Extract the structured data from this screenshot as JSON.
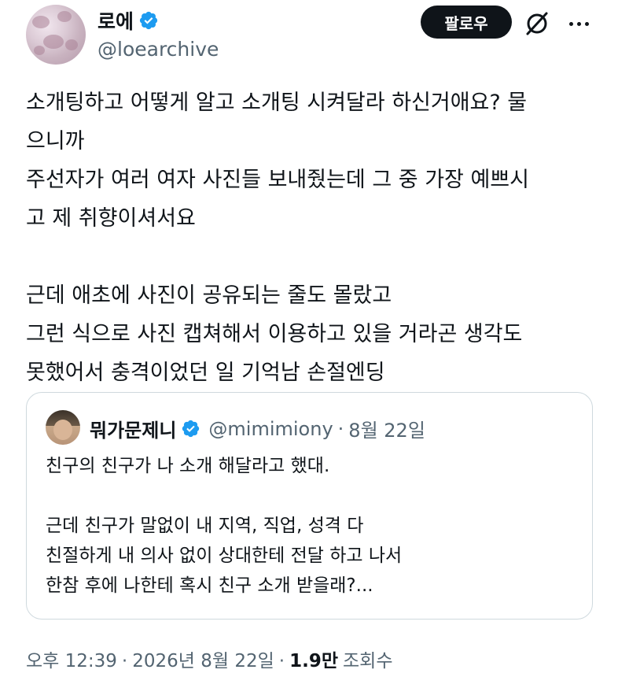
{
  "author": {
    "display_name": "로에",
    "handle": "@loearchive",
    "verified_icon": "verified-badge-icon",
    "accent_color": "#1d9bf0"
  },
  "actions": {
    "follow_label": "팔로우",
    "grok_icon": "grok-icon",
    "more_icon": "more-icon"
  },
  "tweet": {
    "lines": [
      "소개팅하고 어떻게 알고 소개팅 시켜달라 하신거애요? 물",
      "으니까",
      "주선자가 여러 여자 사진들 보내줬는데 그 중 가장 예쁘시",
      "고 제 취향이셔서요",
      "",
      "근데 애초에 사진이 공유되는 줄도 몰랐고",
      "그런 식으로 사진 캡쳐해서 이용하고 있을 거라곤 생각도",
      "못했어서 충격이었던 일 기억남 손절엔딩"
    ]
  },
  "quote": {
    "display_name": "뭐가문제니",
    "handle": "@mimimiony",
    "separator": "·",
    "date": "8월 22일",
    "lines": [
      "친구의 친구가 나 소개 해달라고 했대.",
      "",
      "근데 친구가 말없이 내 지역, 직업, 성격 다",
      "친절하게 내 의사 없이 상대한테 전달 하고 나서",
      "한참 후에 나한테 혹시 친구 소개 받을래?..."
    ]
  },
  "meta": {
    "time": "오후 12:39",
    "separator": "·",
    "date": "2026년 8월 22일",
    "views_count": "1.9만",
    "views_label": "조회수"
  }
}
